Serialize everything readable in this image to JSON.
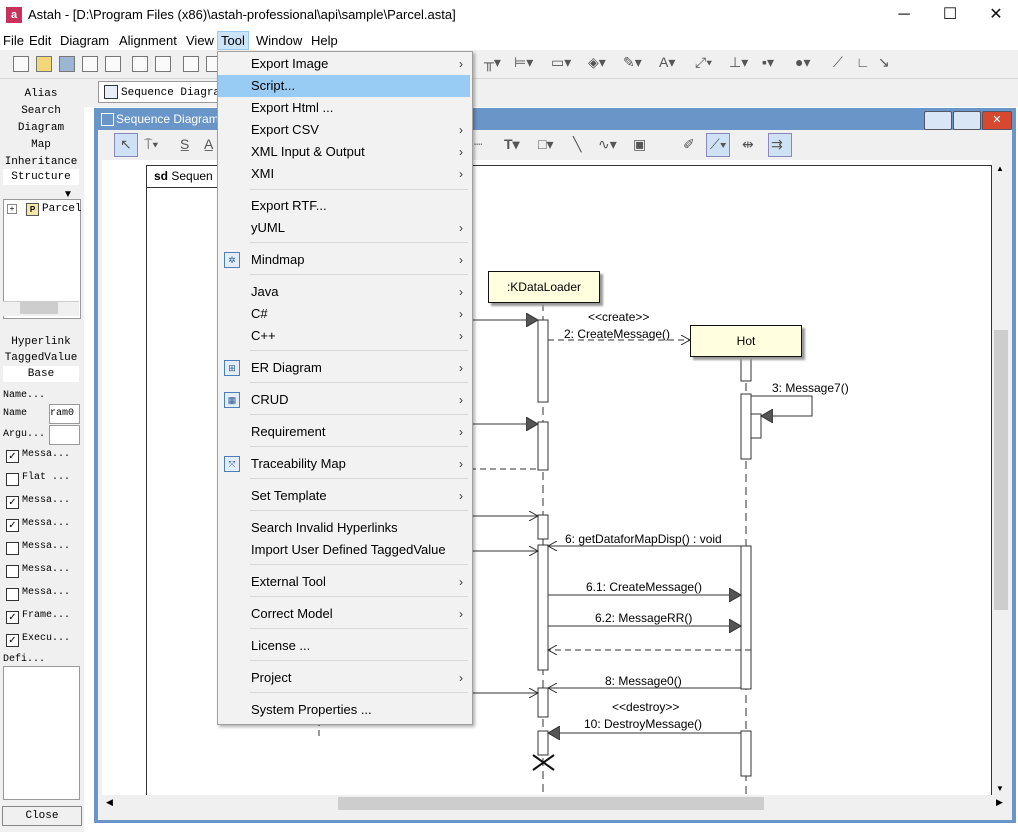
{
  "window": {
    "title": "Astah - [D:\\Program Files (x86)\\astah-professional\\api\\sample\\Parcel.asta]",
    "app_icon": "a",
    "controls": [
      "─",
      "☐",
      "✕"
    ]
  },
  "menubar": [
    "File",
    "Edit",
    "Diagram",
    "Alignment",
    "View",
    "Tool",
    "Window",
    "Help"
  ],
  "left_pane": {
    "tabs": [
      "Alias",
      "Search",
      "Diagram",
      "Map",
      "Inheritance",
      "Structure"
    ],
    "tree_item": "Parcel",
    "tree_item_icon": "P",
    "prop_tabs": [
      "Hyperlink",
      "TaggedValue",
      "Base"
    ],
    "props": {
      "name1": "Name...",
      "name2": "Name",
      "name2_value": "ram0",
      "argu": "Argu...",
      "defi": "Defi..."
    },
    "checkboxes": [
      {
        "label": "Messa...",
        "checked": true
      },
      {
        "label": "Flat ...",
        "checked": false
      },
      {
        "label": "Messa...",
        "checked": true
      },
      {
        "label": "Messa...",
        "checked": true
      },
      {
        "label": "Messa...",
        "checked": false
      },
      {
        "label": "Messa...",
        "checked": false
      },
      {
        "label": "Messa...",
        "checked": false
      },
      {
        "label": "Frame...",
        "checked": true
      },
      {
        "label": "Execu...",
        "checked": true
      }
    ],
    "close_label": "Close"
  },
  "diagram": {
    "tab_label": "Sequence Diagram",
    "inner_title": "Sequence Diagram",
    "frame_label_sd": "sd",
    "frame_label": "Sequen",
    "lifelines": [
      ":KDataLoader",
      "Hot"
    ],
    "messages": {
      "create": "<<create>>",
      "m2": "2: CreateMessage()",
      "m3": "3: Message7()",
      "m6": "6: getDataforMapDisp() : void",
      "m61": "6.1: CreateMessage()",
      "m62": "6.2: MessageRR()",
      "m8": "8: Message0()",
      "destroy": "<<destroy>>",
      "m10": "10: DestroyMessage()"
    }
  },
  "tool_menu": {
    "items": [
      {
        "label": "Export Image",
        "submenu": true
      },
      {
        "label": "Script...",
        "submenu": false,
        "highlighted": true
      },
      {
        "label": "Export Html ...",
        "submenu": false
      },
      {
        "label": "Export CSV",
        "submenu": true
      },
      {
        "label": "XML Input & Output",
        "submenu": true
      },
      {
        "label": "XMI",
        "submenu": true
      },
      {
        "label": "Export RTF...",
        "submenu": false
      },
      {
        "label": "yUML",
        "submenu": true
      },
      {
        "label": "Mindmap",
        "submenu": true,
        "icon": "mindmap-icon"
      },
      {
        "label": "Java",
        "submenu": true
      },
      {
        "label": "C#",
        "submenu": true
      },
      {
        "label": "C++",
        "submenu": true
      },
      {
        "label": "ER Diagram",
        "submenu": true,
        "icon": "er-diagram-icon"
      },
      {
        "label": "CRUD",
        "submenu": true,
        "icon": "crud-icon"
      },
      {
        "label": "Requirement",
        "submenu": true
      },
      {
        "label": "Traceability Map",
        "submenu": true,
        "icon": "traceability-map-icon"
      },
      {
        "label": "Set Template",
        "submenu": true
      },
      {
        "label": "Search Invalid Hyperlinks",
        "submenu": false
      },
      {
        "label": "Import User Defined TaggedValue",
        "submenu": false
      },
      {
        "label": "External Tool",
        "submenu": true
      },
      {
        "label": "Correct Model",
        "submenu": true
      },
      {
        "label": "License ...",
        "submenu": false
      },
      {
        "label": "Project",
        "submenu": true
      },
      {
        "label": "System Properties ...",
        "submenu": false
      }
    ],
    "arrow_glyph": "›"
  }
}
